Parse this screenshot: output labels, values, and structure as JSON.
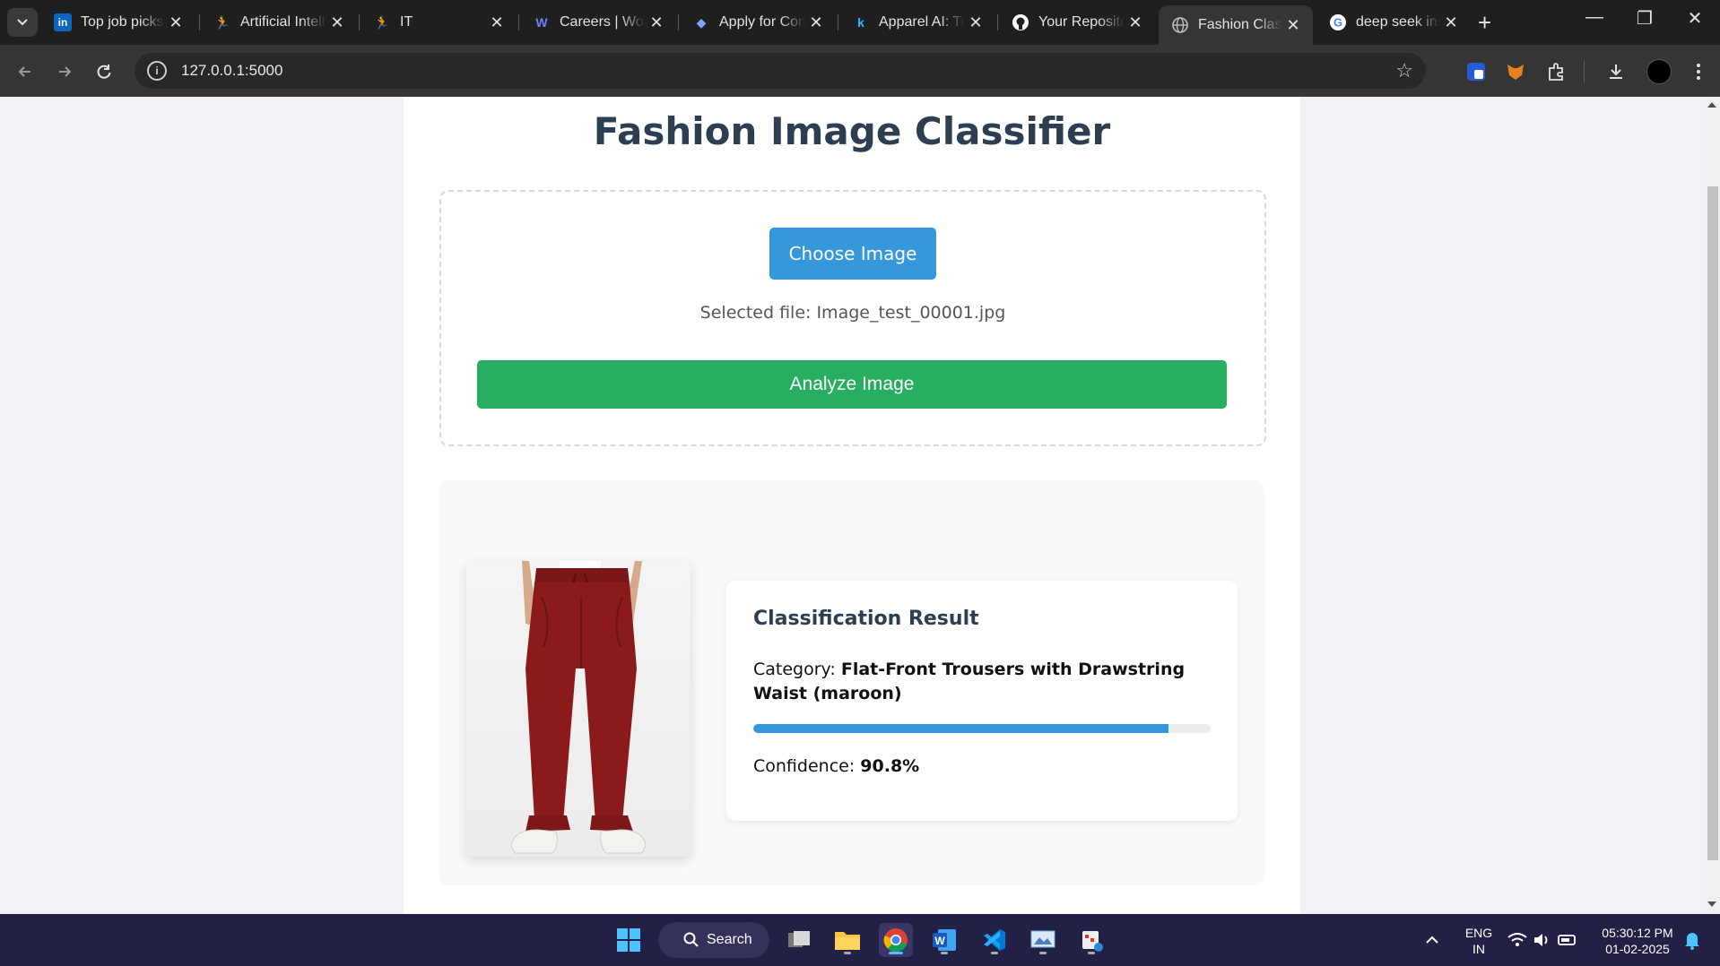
{
  "browser": {
    "tabs": [
      {
        "title": "Top job picks",
        "favicon": "linkedin-icon"
      },
      {
        "title": "Artificial Intelligence",
        "favicon": "runner-icon"
      },
      {
        "title": "IT",
        "favicon": "runner-icon"
      },
      {
        "title": "Careers | Wolters",
        "favicon": "w-icon"
      },
      {
        "title": "Apply for Con",
        "favicon": "diamond-icon"
      },
      {
        "title": "Apparel AI: Tr",
        "favicon": "k-icon"
      },
      {
        "title": "Your Repositories",
        "favicon": "github-icon"
      },
      {
        "title": "Fashion Classifier",
        "favicon": "globe-icon",
        "active": true
      },
      {
        "title": "deep seek ins",
        "favicon": "google-icon"
      }
    ],
    "url": "127.0.0.1:5000"
  },
  "page": {
    "title": "Fashion Image Classifier",
    "choose_label": "Choose Image",
    "selected_file": "Selected file: Image_test_00001.jpg",
    "analyze_label": "Analyze Image"
  },
  "result": {
    "title": "Classification Result",
    "category_label": "Category:",
    "category_value": "Flat-Front Trousers with Drawstring Waist (maroon)",
    "confidence_label": "Confidence:",
    "confidence_value": "90.8%",
    "confidence_fraction": 0.908
  },
  "taskbar": {
    "search_label": "Search",
    "lang_top": "ENG",
    "lang_bottom": "IN",
    "time": "05:30:12 PM",
    "date": "01-02-2025"
  },
  "colors": {
    "primary_button": "#3498db",
    "analyze_button": "#27ae60",
    "title_text": "#2c3e50",
    "garment": "#8b1a1a"
  }
}
